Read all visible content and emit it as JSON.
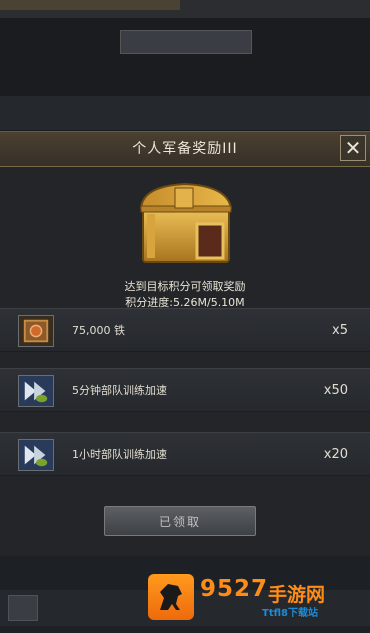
{
  "background": {
    "tab": "",
    "description": "",
    "cells": [
      "",
      "",
      ""
    ],
    "values": [
      "",
      "",
      ""
    ]
  },
  "modal": {
    "title": "个人军备奖励III",
    "close_symbol": "✕",
    "reward_condition": "达到目标积分可领取奖励",
    "progress_text": "积分进度:5.26M/5.10M",
    "items": [
      {
        "label": "75,000 铁",
        "quantity": "x5",
        "icon": "iron-crate-icon"
      },
      {
        "label": "5分钟部队训练加速",
        "quantity": "x50",
        "icon": "speedup-icon"
      },
      {
        "label": "1小时部队训练加速",
        "quantity": "x20",
        "icon": "speedup-icon"
      }
    ],
    "claimed_label": "已领取"
  },
  "watermark": {
    "number": "9527",
    "text": "手游网",
    "sub": "Ttfl8下载站"
  },
  "colors": {
    "accent_gold": "#c89b3c",
    "watermark_orange": "#ff8c17",
    "watermark_blue": "#1e8bd6"
  }
}
